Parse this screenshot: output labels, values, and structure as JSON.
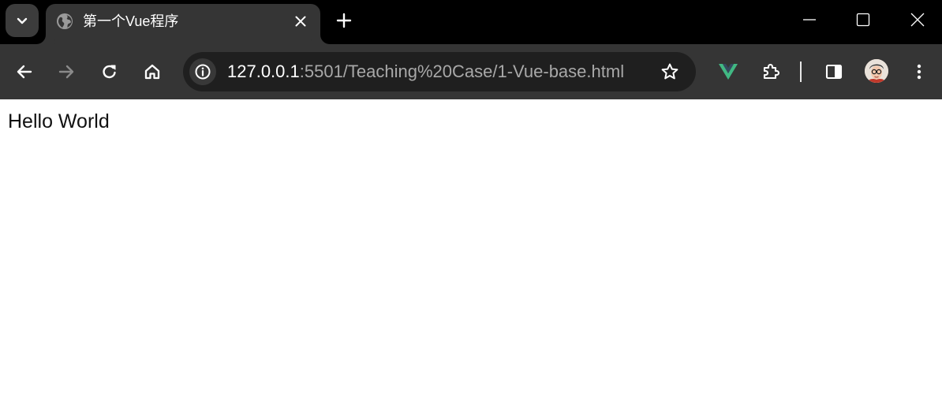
{
  "tab": {
    "title": "第一个Vue程序"
  },
  "address_bar": {
    "host": "127.0.0.1",
    "rest": ":5501/Teaching%20Case/1-Vue-base.html"
  },
  "page": {
    "text": "Hello World"
  },
  "icons": {
    "tab_search": "chevron-down-icon",
    "favicon": "globe-icon",
    "tab_close": "close-icon",
    "new_tab": "plus-icon",
    "minimize": "minimize-icon",
    "maximize": "maximize-icon",
    "close_window": "close-icon",
    "back": "arrow-left-icon",
    "forward": "arrow-right-icon",
    "reload": "reload-icon",
    "home": "home-icon",
    "site_info": "info-icon",
    "bookmark": "star-icon",
    "vue_devtools": "vue-icon",
    "extensions": "puzzle-icon",
    "side_panel": "side-panel-icon",
    "menu": "kebab-menu-icon"
  },
  "colors": {
    "tabstrip": "#000000",
    "active_tab": "#353535",
    "toolbar": "#353535",
    "omnibox": "#1f1f1f",
    "vue_green": "#41b883"
  }
}
